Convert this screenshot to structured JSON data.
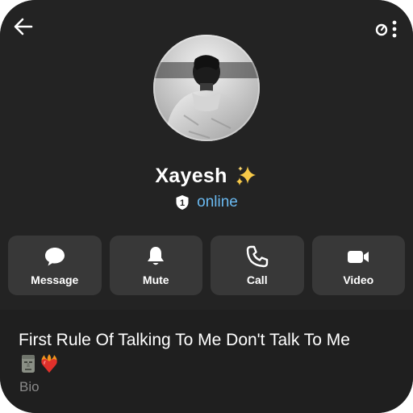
{
  "profile": {
    "name": "Xayesh",
    "status": "online",
    "badge_number": "1"
  },
  "actions": [
    {
      "label": "Message",
      "icon": "message-bubble-icon"
    },
    {
      "label": "Mute",
      "icon": "bell-icon"
    },
    {
      "label": "Call",
      "icon": "phone-icon"
    },
    {
      "label": "Video",
      "icon": "video-camera-icon"
    }
  ],
  "bio": {
    "text": "First Rule Of Talking To Me Don't Talk To Me",
    "emojis": [
      "moai-icon",
      "heart-on-fire-icon"
    ],
    "label": "Bio"
  },
  "colors": {
    "background": "#232323",
    "button": "#383838",
    "status": "#6ab9f0",
    "bio_background": "#1f1f1f",
    "muted_text": "#8a8a8a"
  }
}
